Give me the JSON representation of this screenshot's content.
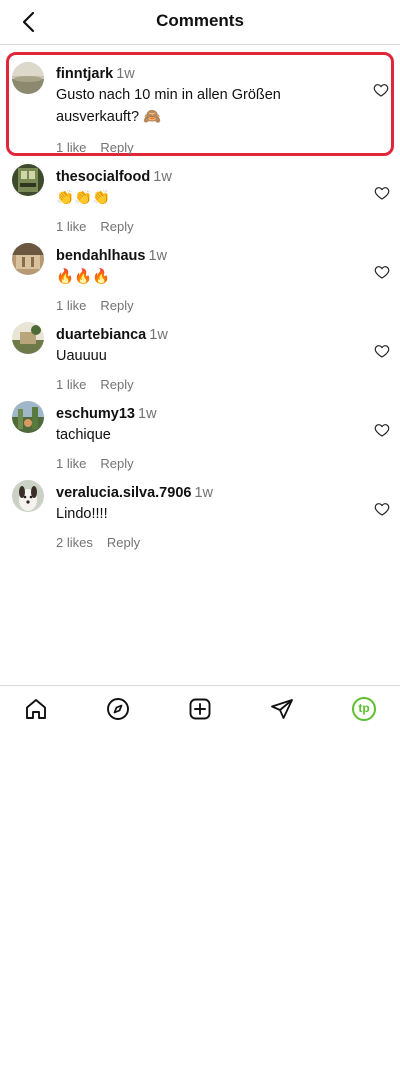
{
  "header": {
    "title": "Comments"
  },
  "comments": [
    {
      "username": "finntjark",
      "time": "1w",
      "text": "Gusto nach 10 min in allen Größen ausverkauft? 🙈",
      "likes": "1 like",
      "reply": "Reply",
      "highlighted": true
    },
    {
      "username": "thesocialfood",
      "time": "1w",
      "text": "👏👏👏",
      "likes": "1 like",
      "reply": "Reply"
    },
    {
      "username": "bendahlhaus",
      "time": "1w",
      "text": "🔥🔥🔥",
      "likes": "1 like",
      "reply": "Reply"
    },
    {
      "username": "duartebianca",
      "time": "1w",
      "text": "Uauuuu",
      "likes": "1 like",
      "reply": "Reply"
    },
    {
      "username": "eschumy13",
      "time": "1w",
      "text": "tachique",
      "likes": "1 like",
      "reply": "Reply"
    },
    {
      "username": "veralucia.silva.7906",
      "time": "1w",
      "text": "Lindo!!!!",
      "likes": "2 likes",
      "reply": "Reply"
    }
  ],
  "nav": {
    "items": [
      "home-icon",
      "explore-icon",
      "create-icon",
      "direct-icon",
      "profile-icon"
    ],
    "profile_text": "tp"
  },
  "colors": {
    "highlight": "#e02638",
    "muted": "#737373",
    "profile": "#5bbf2c"
  }
}
